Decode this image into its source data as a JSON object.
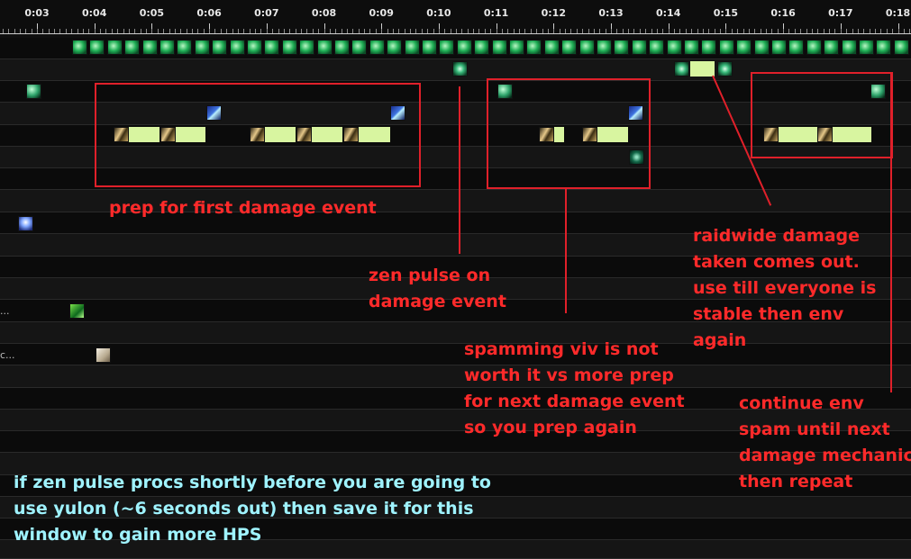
{
  "timeline": {
    "ticks": [
      "0:03",
      "0:04",
      "0:05",
      "0:06",
      "0:07",
      "0:08",
      "0:09",
      "0:10",
      "0:11",
      "0:12",
      "0:13",
      "0:14",
      "0:15",
      "0:16",
      "0:17",
      "0:18"
    ]
  },
  "tracks": {
    "truncated_labels": [
      "...",
      "c..."
    ]
  },
  "annotations": {
    "prep_first": "prep for first damage event",
    "zen_pulse": [
      "zen pulse on",
      "damage event"
    ],
    "spamming_viv": [
      "spamming viv is not",
      "worth it vs more prep",
      "for next damage event",
      "so you prep again"
    ],
    "raidwide": [
      "raidwide damage",
      "taken comes out.",
      "use till everyone is",
      "stable then env",
      "again"
    ],
    "continue_env": [
      "continue env",
      "spam until next",
      "damage mechanic",
      "then repeat"
    ],
    "yulon_tip": [
      "if zen pulse procs shortly before you are going to",
      "use yulon (~6 seconds out) then save it for this",
      "window to gain more HPS"
    ]
  },
  "colors": {
    "annotation_red": "#ff2a2a",
    "annotation_cyan": "#9ff3ff",
    "highlight_box": "#e0202a",
    "channel_bar": "#d8f5a0"
  }
}
